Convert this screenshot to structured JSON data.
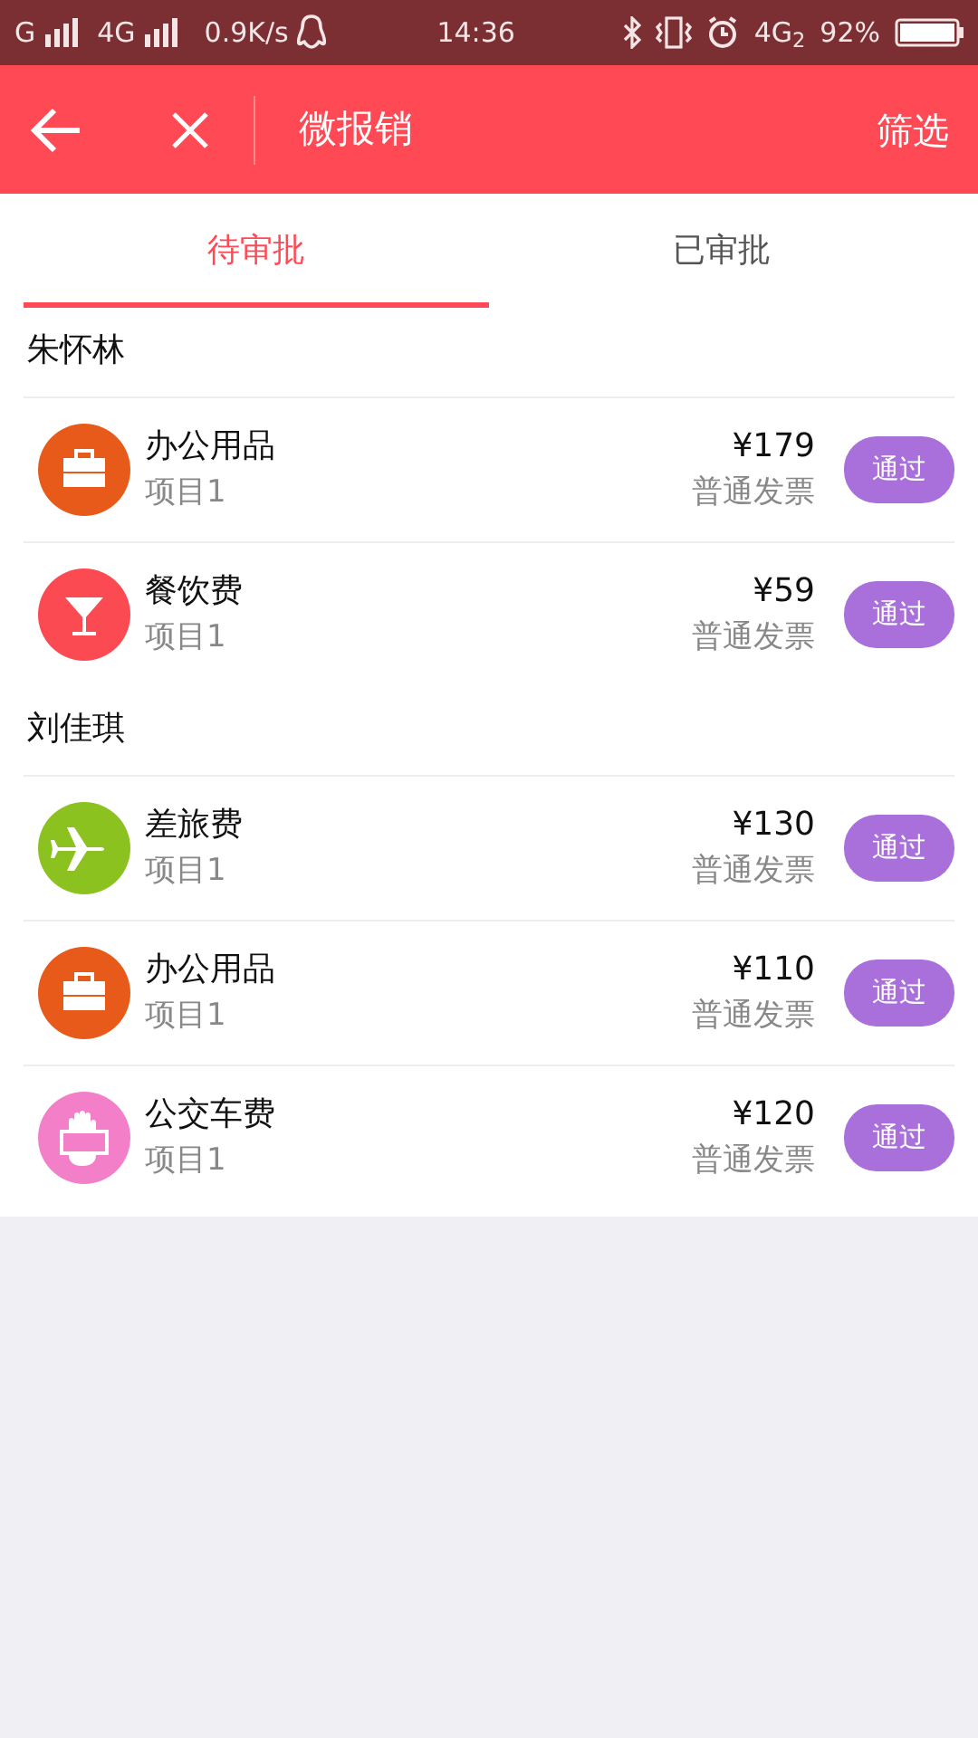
{
  "status_bar": {
    "carrier_1": "G",
    "carrier_2": "4G",
    "speed": "0.9K/s",
    "time": "14:36",
    "network": "4G$_{2}$",
    "battery": "92%"
  },
  "header": {
    "title": "微报销",
    "action": "筛选"
  },
  "tabs": [
    {
      "label": "待审批",
      "selected": true
    },
    {
      "label": "已审批",
      "selected": false
    }
  ],
  "groups": [
    {
      "name": "朱怀林",
      "items": [
        {
          "kind": "briefcase",
          "color": "#e85a19",
          "title": "办公用品",
          "project": "项目1",
          "amount": "¥179",
          "invoice": "普通发票",
          "button": "通过"
        },
        {
          "kind": "cocktail",
          "color": "#fb4a52",
          "title": "餐饮费",
          "project": "项目1",
          "amount": "¥59",
          "invoice": "普通发票",
          "button": "通过"
        }
      ]
    },
    {
      "name": "刘佳琪",
      "items": [
        {
          "kind": "plane",
          "color": "#8cc21f",
          "title": "差旅费",
          "project": "项目1",
          "amount": "¥130",
          "invoice": "普通发票",
          "button": "通过"
        },
        {
          "kind": "briefcase",
          "color": "#e85a19",
          "title": "办公用品",
          "project": "项目1",
          "amount": "¥110",
          "invoice": "普通发票",
          "button": "通过"
        },
        {
          "kind": "hand",
          "color": "#f27fc8",
          "title": "公交车费",
          "project": "项目1",
          "amount": "¥120",
          "invoice": "普通发票",
          "button": "通过"
        }
      ]
    }
  ]
}
